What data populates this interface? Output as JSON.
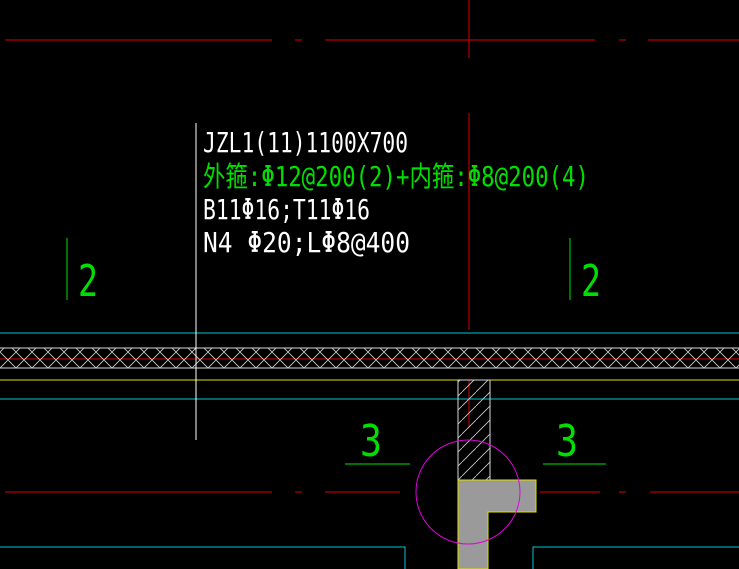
{
  "colors": {
    "background": "#000000",
    "white": "#ffffff",
    "green": "#00e000",
    "red": "#e00000",
    "cyan": "#00c8d0",
    "yellow": "#e0e000",
    "magenta": "#e000e0",
    "grey_fill": "#9a9a9a"
  },
  "annotation": {
    "beam_id": "JZL1(11)1100X700",
    "stirrups": "外箍:Φ12@200(2)+内箍:Φ8@200(4)",
    "longitudinal": "B11Φ16;T11Φ16",
    "side_bars": "N4 Φ20;LΦ8@400"
  },
  "labels": {
    "section_left": "2",
    "section_right": "2",
    "section_bottom_left": "3",
    "section_bottom_right": "3"
  }
}
